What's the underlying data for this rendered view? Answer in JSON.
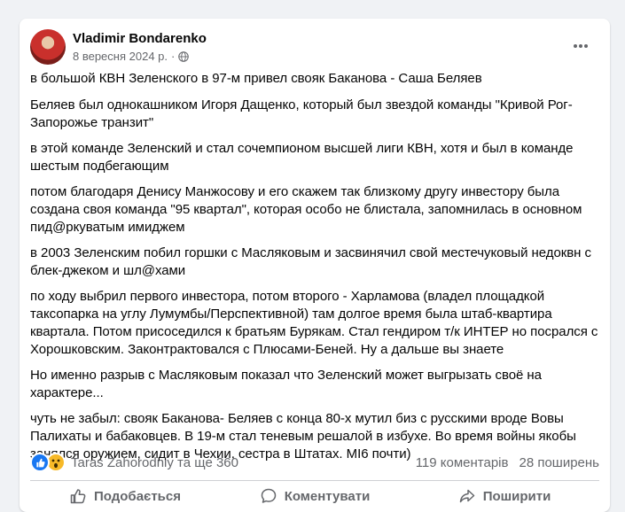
{
  "post": {
    "author": "Vladimir Bondarenko",
    "date": "8 вересня 2024 р.",
    "separator": "·",
    "paragraphs": [
      "в большой КВН Зеленского в 97-м привел свояк Баканова - Саша Беляев",
      "Беляев был однокашником Игоря Дащенко, который был звездой команды \"Кривой Рог-Запорожье транзит\"",
      "в этой команде Зеленский и стал сочемпионом высшей лиги КВН, хотя и был в команде шестым подбегающим",
      "потом благодаря Денису Манжосову и его скажем так близкому другу инвестору была создана своя команда \"95 квартал\", которая особо не блистала, запомнилась в основном пид@ркуватым имиджем",
      "в 2003 Зеленским побил горшки с Масляковым и засвинячил свой местечуковый недоквн с блек-джеком и шл@хами",
      "по ходу выбрил первого инвестора, потом второго - Харламова (владел площадкой таксопарка на углу Лумумбы/Перспективной) там долгое время была штаб-квартира квартала. Потом присоседился к братьям Бурякам. Стал гендиром т/к ИНТЕР но посрался с Хорошковским. Законтрактовался с Плюсами-Беней. Ну а дальше вы знаете",
      "Но именно разрыв с Масляковым показал что Зеленский может выгрызать своё на характере...",
      "чуть не забыл: свояк Баканова- Беляев с конца 80-х мутил биз с русскими вроде Вовы Палихаты и бабаковцев. В 19-м стал теневым решалой в избухе. Во время войны якобы занялся оружием, сидит в Чехии, сестра в Штатах. MI6 почти)"
    ]
  },
  "stats": {
    "reactions_text": "Taras Zahorodniy та ще 360",
    "comments": "119 коментарів",
    "shares": "28 поширень"
  },
  "actions": {
    "like": "Подобається",
    "comment": "Коментувати",
    "share": "Поширити"
  },
  "icons": {
    "more": "more-horizontal-icon",
    "privacy": "globe-icon",
    "like_reaction": "like-reaction-icon",
    "wow_reaction": "wow-reaction-icon"
  },
  "colors": {
    "background": "#f0f2f5",
    "card": "#ffffff",
    "secondary_text": "#65676b",
    "like_blue": "#1877f2",
    "wow_yellow": "#f7b928"
  }
}
